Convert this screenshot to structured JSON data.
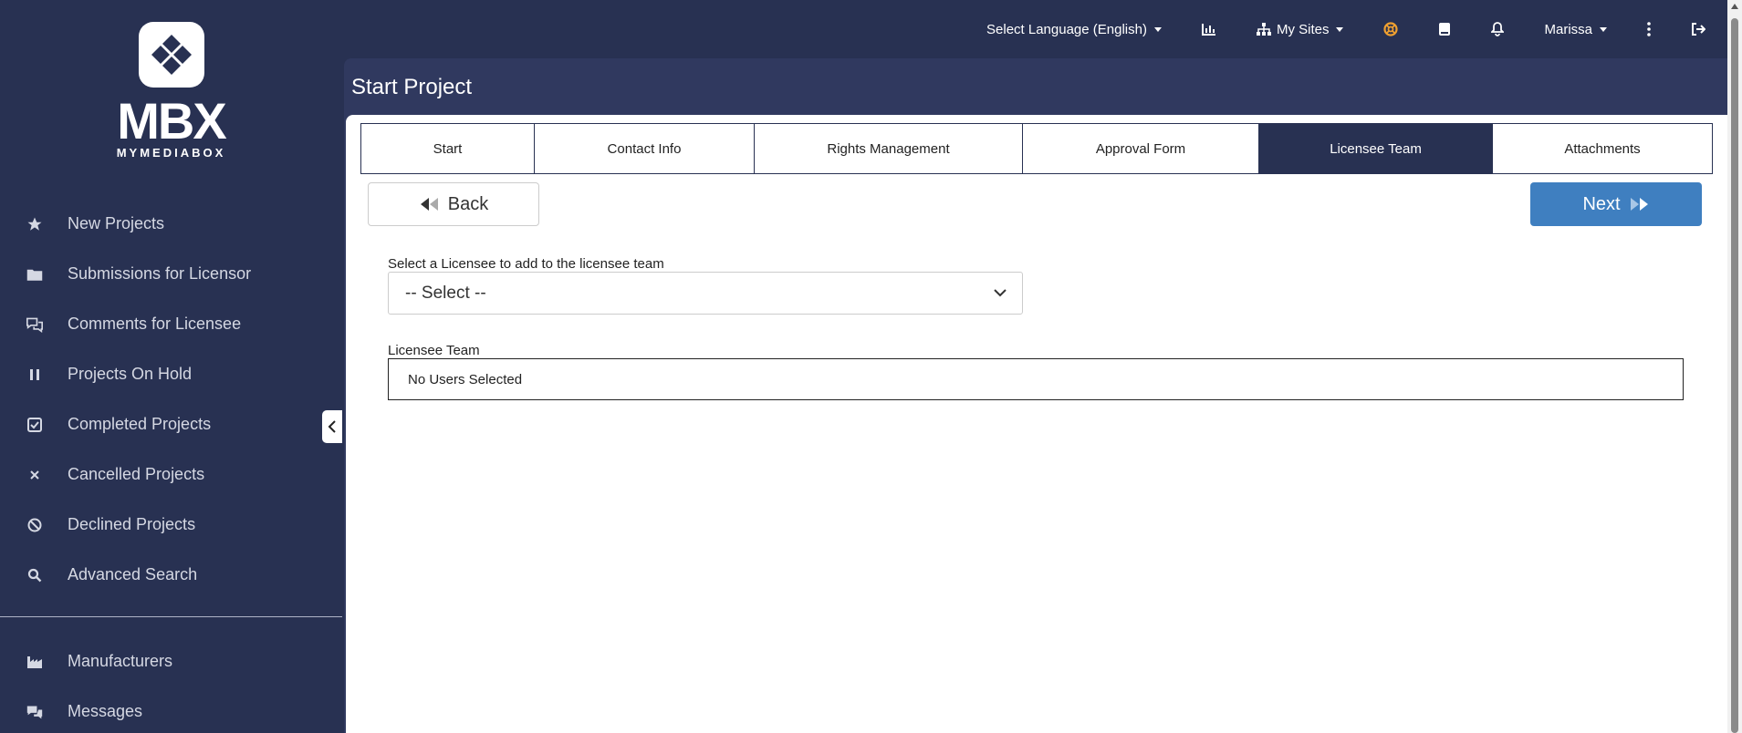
{
  "brand": {
    "logo_text": "MBX",
    "logo_sub": "MYMEDIABOX"
  },
  "sidebar": {
    "items": [
      {
        "label": "New Projects",
        "icon": "star-icon"
      },
      {
        "label": "Submissions for Licensor",
        "icon": "folder-icon"
      },
      {
        "label": "Comments for Licensee",
        "icon": "comments-icon"
      },
      {
        "label": "Projects On Hold",
        "icon": "pause-icon"
      },
      {
        "label": "Completed Projects",
        "icon": "check-square-icon"
      },
      {
        "label": "Cancelled Projects",
        "icon": "x-icon"
      },
      {
        "label": "Declined Projects",
        "icon": "ban-icon"
      },
      {
        "label": "Advanced Search",
        "icon": "search-icon"
      }
    ],
    "items2": [
      {
        "label": "Manufacturers",
        "icon": "industry-icon"
      },
      {
        "label": "Messages",
        "icon": "messages-icon"
      }
    ]
  },
  "topbar": {
    "language": "Select Language (English)",
    "my_sites": "My Sites",
    "user": "Marissa"
  },
  "page": {
    "title": "Start Project"
  },
  "tabs": [
    {
      "label": "Start",
      "active": false
    },
    {
      "label": "Contact Info",
      "active": false
    },
    {
      "label": "Rights Management",
      "active": false
    },
    {
      "label": "Approval Form",
      "active": false
    },
    {
      "label": "Licensee Team",
      "active": true
    },
    {
      "label": "Attachments",
      "active": false
    }
  ],
  "buttons": {
    "back": "Back",
    "next": "Next"
  },
  "form": {
    "select_label": "Select a Licensee to add to the licensee team",
    "select_value": "-- Select --",
    "team_label": "Licensee Team",
    "team_value": "No Users Selected"
  },
  "colors": {
    "sidebar_bg": "#283152",
    "header_bg": "#30395f",
    "active_tab": "#283152",
    "next_button": "#3f7fc0"
  }
}
